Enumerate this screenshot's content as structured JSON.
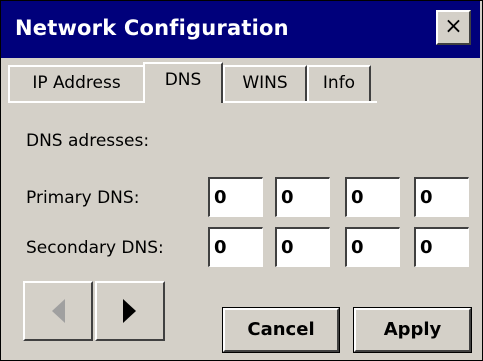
{
  "window": {
    "title": "Network Configuration",
    "close_label": "×"
  },
  "tabs": [
    {
      "label": "IP Address",
      "active": false
    },
    {
      "label": "DNS",
      "active": true
    },
    {
      "label": "WINS",
      "active": false
    },
    {
      "label": "Info",
      "active": false
    }
  ],
  "dns": {
    "section_label": "DNS adresses:",
    "primary_label": "Primary DNS:",
    "secondary_label": "Secondary DNS:",
    "primary": [
      "0",
      "0",
      "0",
      "0"
    ],
    "secondary": [
      "0",
      "0",
      "0",
      "0"
    ]
  },
  "nav": {
    "left_icon": "arrow-left-icon",
    "right_icon": "arrow-right-icon",
    "left_enabled": false,
    "right_enabled": true
  },
  "buttons": {
    "cancel_label": "Cancel",
    "apply_label": "Apply"
  },
  "colors": {
    "titlebar": "#00007b",
    "face": "#d4d0c8"
  }
}
